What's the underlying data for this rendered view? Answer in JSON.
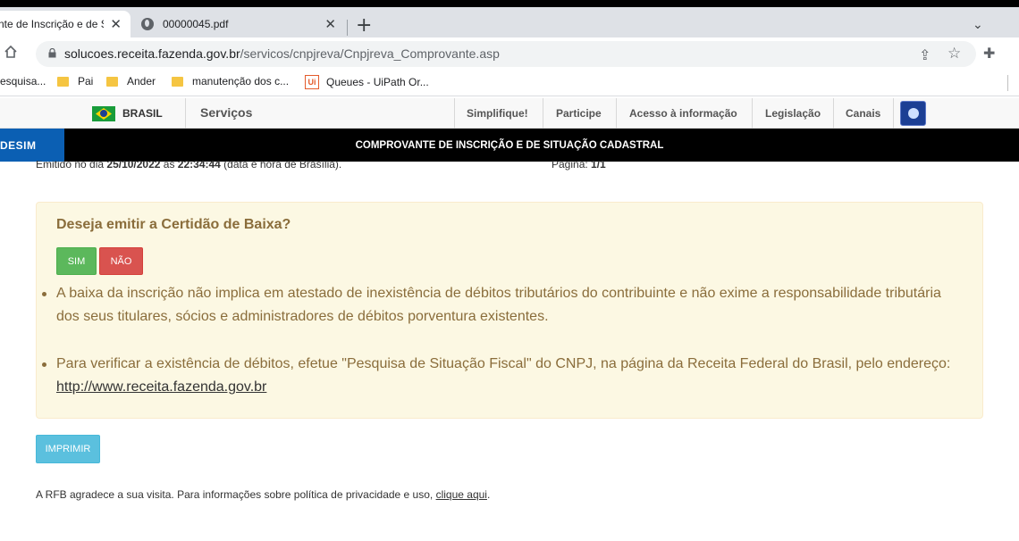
{
  "browser": {
    "tabs": [
      {
        "title": "nte de Inscrição e de S",
        "close": "✕"
      },
      {
        "title": "00000045.pdf",
        "close": "✕"
      }
    ],
    "new_tab": "+",
    "tab_menu": "⌄",
    "url_host": "solucoes.receita.fazenda.gov.br",
    "url_path": "/servicos/cnpjreva/Cnpjreva_Comprovante.asp",
    "bookmarks": [
      {
        "label": "esquisa..."
      },
      {
        "label": "Pai"
      },
      {
        "label": "Ander"
      },
      {
        "label": "manutenção dos  c..."
      },
      {
        "label": "Queues - UiPath Or...",
        "icon_text": "Ui"
      }
    ]
  },
  "gov_bar": {
    "brasil": "BRASIL",
    "servicos": "Serviços",
    "links": [
      "Simplifique!",
      "Participe",
      "Acesso à informação",
      "Legislação",
      "Canais"
    ]
  },
  "redesim": {
    "logo": "DESIM",
    "title": "COMPROVANTE DE INSCRIÇÃO E DE SITUAÇÃO CADASTRAL"
  },
  "partial": {
    "emitido_prefix": "Emitido no dia ",
    "emitido_date": "25/10/2022",
    "emitido_as": " às ",
    "emitido_time": "22:34:44",
    "emitido_suffix": " (data e hora de Brasília).",
    "pagina_label": "Página: ",
    "pagina_value": "1/1"
  },
  "panel": {
    "title": "Deseja emitir a Certidão de Baixa?",
    "sim": "SIM",
    "nao": "NÃO",
    "bullet1": "A baixa da inscrição não implica em atestado de inexistência de débitos tributários do contribuinte e não exime a responsabilidade tributária dos seus titulares, sócios e administradores de débitos porventura existentes.",
    "bullet2_text": "Para verificar a existência de débitos, efetue \"Pesquisa de Situação Fiscal\" do CNPJ, na página da Receita Federal do Brasil, pelo endereço: ",
    "bullet2_link": "http://www.receita.fazenda.gov.br"
  },
  "imprimir": "IMPRIMIR",
  "footer": {
    "text": "A RFB agradece a sua visita. Para informações sobre política de privacidade e uso, ",
    "link": "clique aqui",
    "end": "."
  }
}
